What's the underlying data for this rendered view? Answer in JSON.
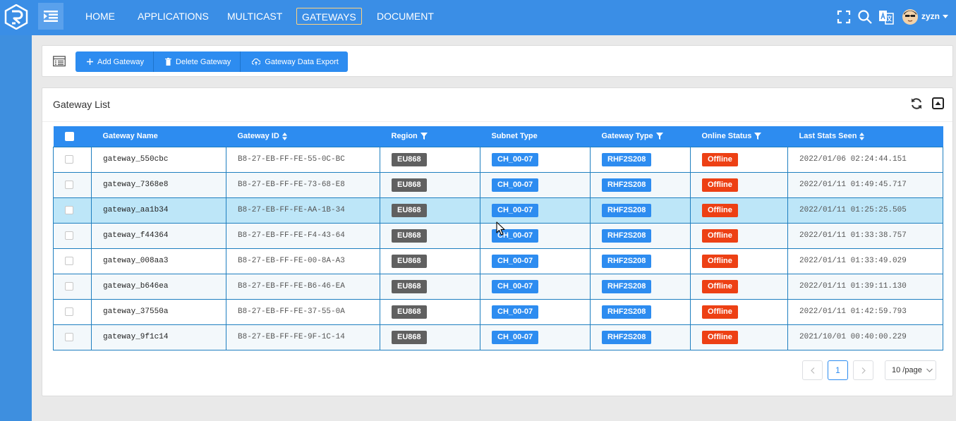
{
  "nav": {
    "items": [
      {
        "label": "HOME",
        "active": false
      },
      {
        "label": "APPLICATIONS",
        "active": false
      },
      {
        "label": "MULTICAST",
        "active": false
      },
      {
        "label": "GATEWAYS",
        "active": true
      },
      {
        "label": "DOCUMENT",
        "active": false
      }
    ],
    "user": "zyzn"
  },
  "toolbar": {
    "add_label": "Add Gateway",
    "delete_label": "Delete Gateway",
    "export_label": "Gateway Data Export"
  },
  "list": {
    "title": "Gateway List",
    "columns": [
      "Gateway Name",
      "Gateway ID",
      "Region",
      "Subnet Type",
      "Gateway Type",
      "Online Status",
      "Last Stats Seen"
    ],
    "rows": [
      {
        "name": "gateway_550cbc",
        "id": "B8-27-EB-FF-FE-55-0C-BC",
        "region": "EU868",
        "subnet": "CH_00-07",
        "type": "RHF2S208",
        "status": "Offline",
        "last_seen": "2022/01/06 02:24:44.151"
      },
      {
        "name": "gateway_7368e8",
        "id": "B8-27-EB-FF-FE-73-68-E8",
        "region": "EU868",
        "subnet": "CH_00-07",
        "type": "RHF2S208",
        "status": "Offline",
        "last_seen": "2022/01/11 01:49:45.717"
      },
      {
        "name": "gateway_aa1b34",
        "id": "B8-27-EB-FF-FE-AA-1B-34",
        "region": "EU868",
        "subnet": "CH_00-07",
        "type": "RHF2S208",
        "status": "Offline",
        "last_seen": "2022/01/11 01:25:25.505"
      },
      {
        "name": "gateway_f44364",
        "id": "B8-27-EB-FF-FE-F4-43-64",
        "region": "EU868",
        "subnet": "CH_00-07",
        "type": "RHF2S208",
        "status": "Offline",
        "last_seen": "2022/01/11 01:33:38.757"
      },
      {
        "name": "gateway_008aa3",
        "id": "B8-27-EB-FF-FE-00-8A-A3",
        "region": "EU868",
        "subnet": "CH_00-07",
        "type": "RHF2S208",
        "status": "Offline",
        "last_seen": "2022/01/11 01:33:49.029"
      },
      {
        "name": "gateway_b646ea",
        "id": "B8-27-EB-FF-FE-B6-46-EA",
        "region": "EU868",
        "subnet": "CH_00-07",
        "type": "RHF2S208",
        "status": "Offline",
        "last_seen": "2022/01/11 01:39:11.130"
      },
      {
        "name": "gateway_37550a",
        "id": "B8-27-EB-FF-FE-37-55-0A",
        "region": "EU868",
        "subnet": "CH_00-07",
        "type": "RHF2S208",
        "status": "Offline",
        "last_seen": "2022/01/11 01:42:59.793"
      },
      {
        "name": "gateway_9f1c14",
        "id": "B8-27-EB-FF-FE-9F-1C-14",
        "region": "EU868",
        "subnet": "CH_00-07",
        "type": "RHF2S208",
        "status": "Offline",
        "last_seen": "2021/10/01 00:40:00.229"
      }
    ]
  },
  "pagination": {
    "current_page": "1",
    "page_size": "10 /page"
  },
  "colors": {
    "topbar": "#3a8ee6",
    "primary": "#2d8cf0",
    "offline": "#ed4014",
    "region_tag": "#606060",
    "selected_row": "#bde6f8"
  },
  "icons": [
    "logo-icon",
    "menu-toggle-icon",
    "fullscreen-icon",
    "search-icon",
    "translate-icon",
    "avatar",
    "list-icon",
    "plus-icon",
    "trash-icon",
    "cloud-upload-icon",
    "refresh-icon",
    "collapse-icon",
    "sort-icon",
    "filter-icon",
    "chevron-left-icon",
    "chevron-right-icon",
    "chevron-down-icon",
    "mouse-cursor"
  ]
}
